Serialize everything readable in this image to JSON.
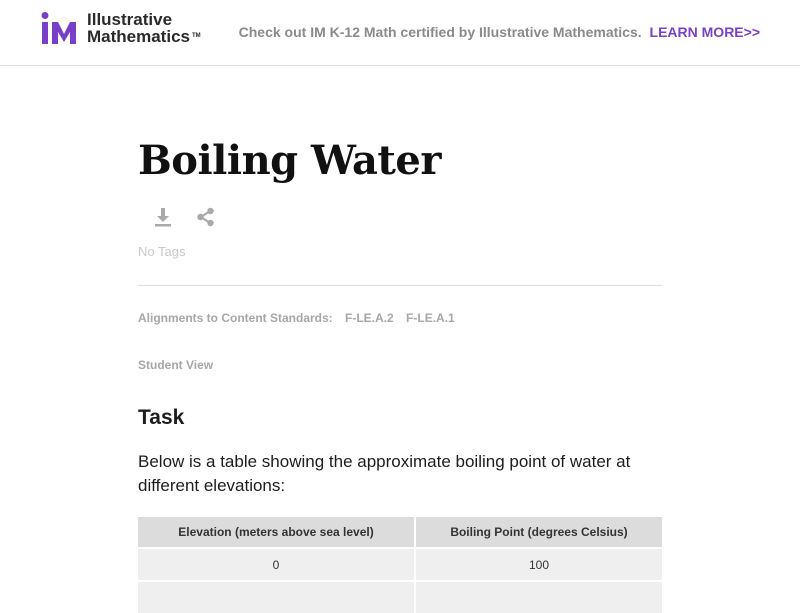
{
  "header": {
    "logo": {
      "line1": "Illustrative",
      "line2": "Mathematics",
      "tm": "TM",
      "mark_color": "#7a3fc8"
    },
    "promo_text": "Check out IM K-12 Math certified by Illustrative Mathematics.",
    "promo_link": "LEARN MORE>>",
    "link_color": "#7a3fc8"
  },
  "page": {
    "title": "Boiling Water",
    "icons": [
      "download-icon",
      "share-icon"
    ],
    "tags_text": "No Tags",
    "alignments_label": "Alignments to Content Standards:",
    "standards": [
      "F-LE.A.2",
      "F-LE.A.1"
    ],
    "student_view": "Student View",
    "task_heading": "Task",
    "task_paragraph": "Below is a table showing the approximate boiling point of water at different elevations:",
    "table": {
      "headers": [
        "Elevation (meters above sea level)",
        "Boiling Point (degrees Celsius)"
      ],
      "rows": [
        [
          "0",
          "100"
        ],
        [
          "",
          ""
        ]
      ]
    }
  }
}
